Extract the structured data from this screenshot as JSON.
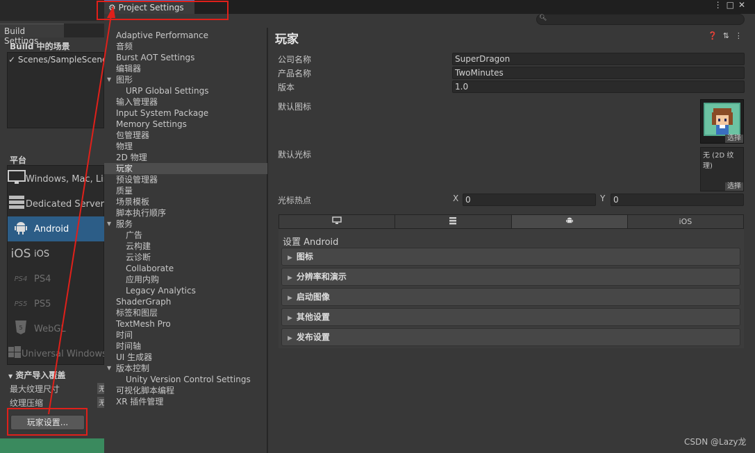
{
  "build_settings": {
    "tab_label": "Build Settings",
    "scenes_title": "Build 中的场景",
    "scenes": [
      {
        "label": "Scenes/SampleScene",
        "checked": true
      }
    ],
    "platform_title": "平台",
    "platforms": [
      {
        "label": "Windows, Mac, Linux",
        "icon": "monitor-icon",
        "state": "normal"
      },
      {
        "label": "Dedicated Server",
        "icon": "server-icon",
        "state": "normal"
      },
      {
        "label": "Android",
        "icon": "android-icon",
        "state": "selected"
      },
      {
        "label": "iOS",
        "icon_text": "iOS",
        "icon": "ios-icon",
        "state": "normal"
      },
      {
        "label": "PS4",
        "icon_text": "PS4",
        "icon": "ps4-icon",
        "state": "dim"
      },
      {
        "label": "PS5",
        "icon_text": "PS5",
        "icon": "ps5-icon",
        "state": "dim"
      },
      {
        "label": "WebGL",
        "icon": "html5-icon",
        "state": "dim"
      },
      {
        "label": "Universal Windows Platform",
        "icon": "windows-icon",
        "state": "dim"
      }
    ],
    "asset_import_title": "资产导入覆盖",
    "max_texture_label": "最大纹理尺寸",
    "texture_compression_label": "纹理压缩",
    "mini_field_1": "无",
    "mini_field_2": "无",
    "player_settings_button": "玩家设置..."
  },
  "project_settings": {
    "tab_label": "Project Settings",
    "nav": [
      {
        "label": "Adaptive Performance",
        "level": 0
      },
      {
        "label": "音频",
        "level": 0
      },
      {
        "label": "Burst AOT Settings",
        "level": 0
      },
      {
        "label": "编辑器",
        "level": 0
      },
      {
        "label": "图形",
        "level": 0,
        "expanded": true
      },
      {
        "label": "URP Global Settings",
        "level": 1
      },
      {
        "label": "输入管理器",
        "level": 0
      },
      {
        "label": "Input System Package",
        "level": 0
      },
      {
        "label": "Memory Settings",
        "level": 0
      },
      {
        "label": "包管理器",
        "level": 0
      },
      {
        "label": "物理",
        "level": 0
      },
      {
        "label": "2D 物理",
        "level": 0
      },
      {
        "label": "玩家",
        "level": 0,
        "selected": true
      },
      {
        "label": "预设管理器",
        "level": 0
      },
      {
        "label": "质量",
        "level": 0
      },
      {
        "label": "场景模板",
        "level": 0
      },
      {
        "label": "脚本执行顺序",
        "level": 0
      },
      {
        "label": "服务",
        "level": 0,
        "expanded": true
      },
      {
        "label": "广告",
        "level": 1
      },
      {
        "label": "云构建",
        "level": 1
      },
      {
        "label": "云诊断",
        "level": 1
      },
      {
        "label": "Collaborate",
        "level": 1
      },
      {
        "label": "应用内购",
        "level": 1
      },
      {
        "label": "Legacy Analytics",
        "level": 1
      },
      {
        "label": "ShaderGraph",
        "level": 0
      },
      {
        "label": "标签和图层",
        "level": 0
      },
      {
        "label": "TextMesh Pro",
        "level": 0
      },
      {
        "label": "时间",
        "level": 0
      },
      {
        "label": "时间轴",
        "level": 0
      },
      {
        "label": "UI 生成器",
        "level": 0
      },
      {
        "label": "版本控制",
        "level": 0,
        "expanded": true
      },
      {
        "label": "Unity Version Control Settings",
        "level": 1
      },
      {
        "label": "可视化脚本编程",
        "level": 0
      },
      {
        "label": "XR 插件管理",
        "level": 0
      }
    ],
    "player": {
      "title": "玩家",
      "company_label": "公司名称",
      "company_value": "SuperDragon",
      "product_label": "产品名称",
      "product_value": "TwoMinutes",
      "version_label": "版本",
      "version_value": "1.0",
      "default_icon_label": "默认图标",
      "default_cursor_label": "默认光标",
      "cursor_none_text": "无 (2D 纹理)",
      "select_label": "选择",
      "hotspot_label": "光标热点",
      "hotspot_x_label": "X",
      "hotspot_x": "0",
      "hotspot_y_label": "Y",
      "hotspot_y": "0",
      "platform_tabs": [
        {
          "icon": "monitor-icon",
          "active": false
        },
        {
          "icon": "server-icon",
          "active": false
        },
        {
          "icon": "android-icon",
          "active": true
        },
        {
          "label": "iOS",
          "active": false
        }
      ],
      "platform_settings_label": "设置 Android",
      "sections": [
        "图标",
        "分辨率和演示",
        "启动图像",
        "其他设置",
        "发布设置"
      ]
    }
  },
  "watermark": "CSDN @Lazy龙",
  "colors": {
    "selection": "#2c5d87",
    "annotation": "#e0201a"
  }
}
